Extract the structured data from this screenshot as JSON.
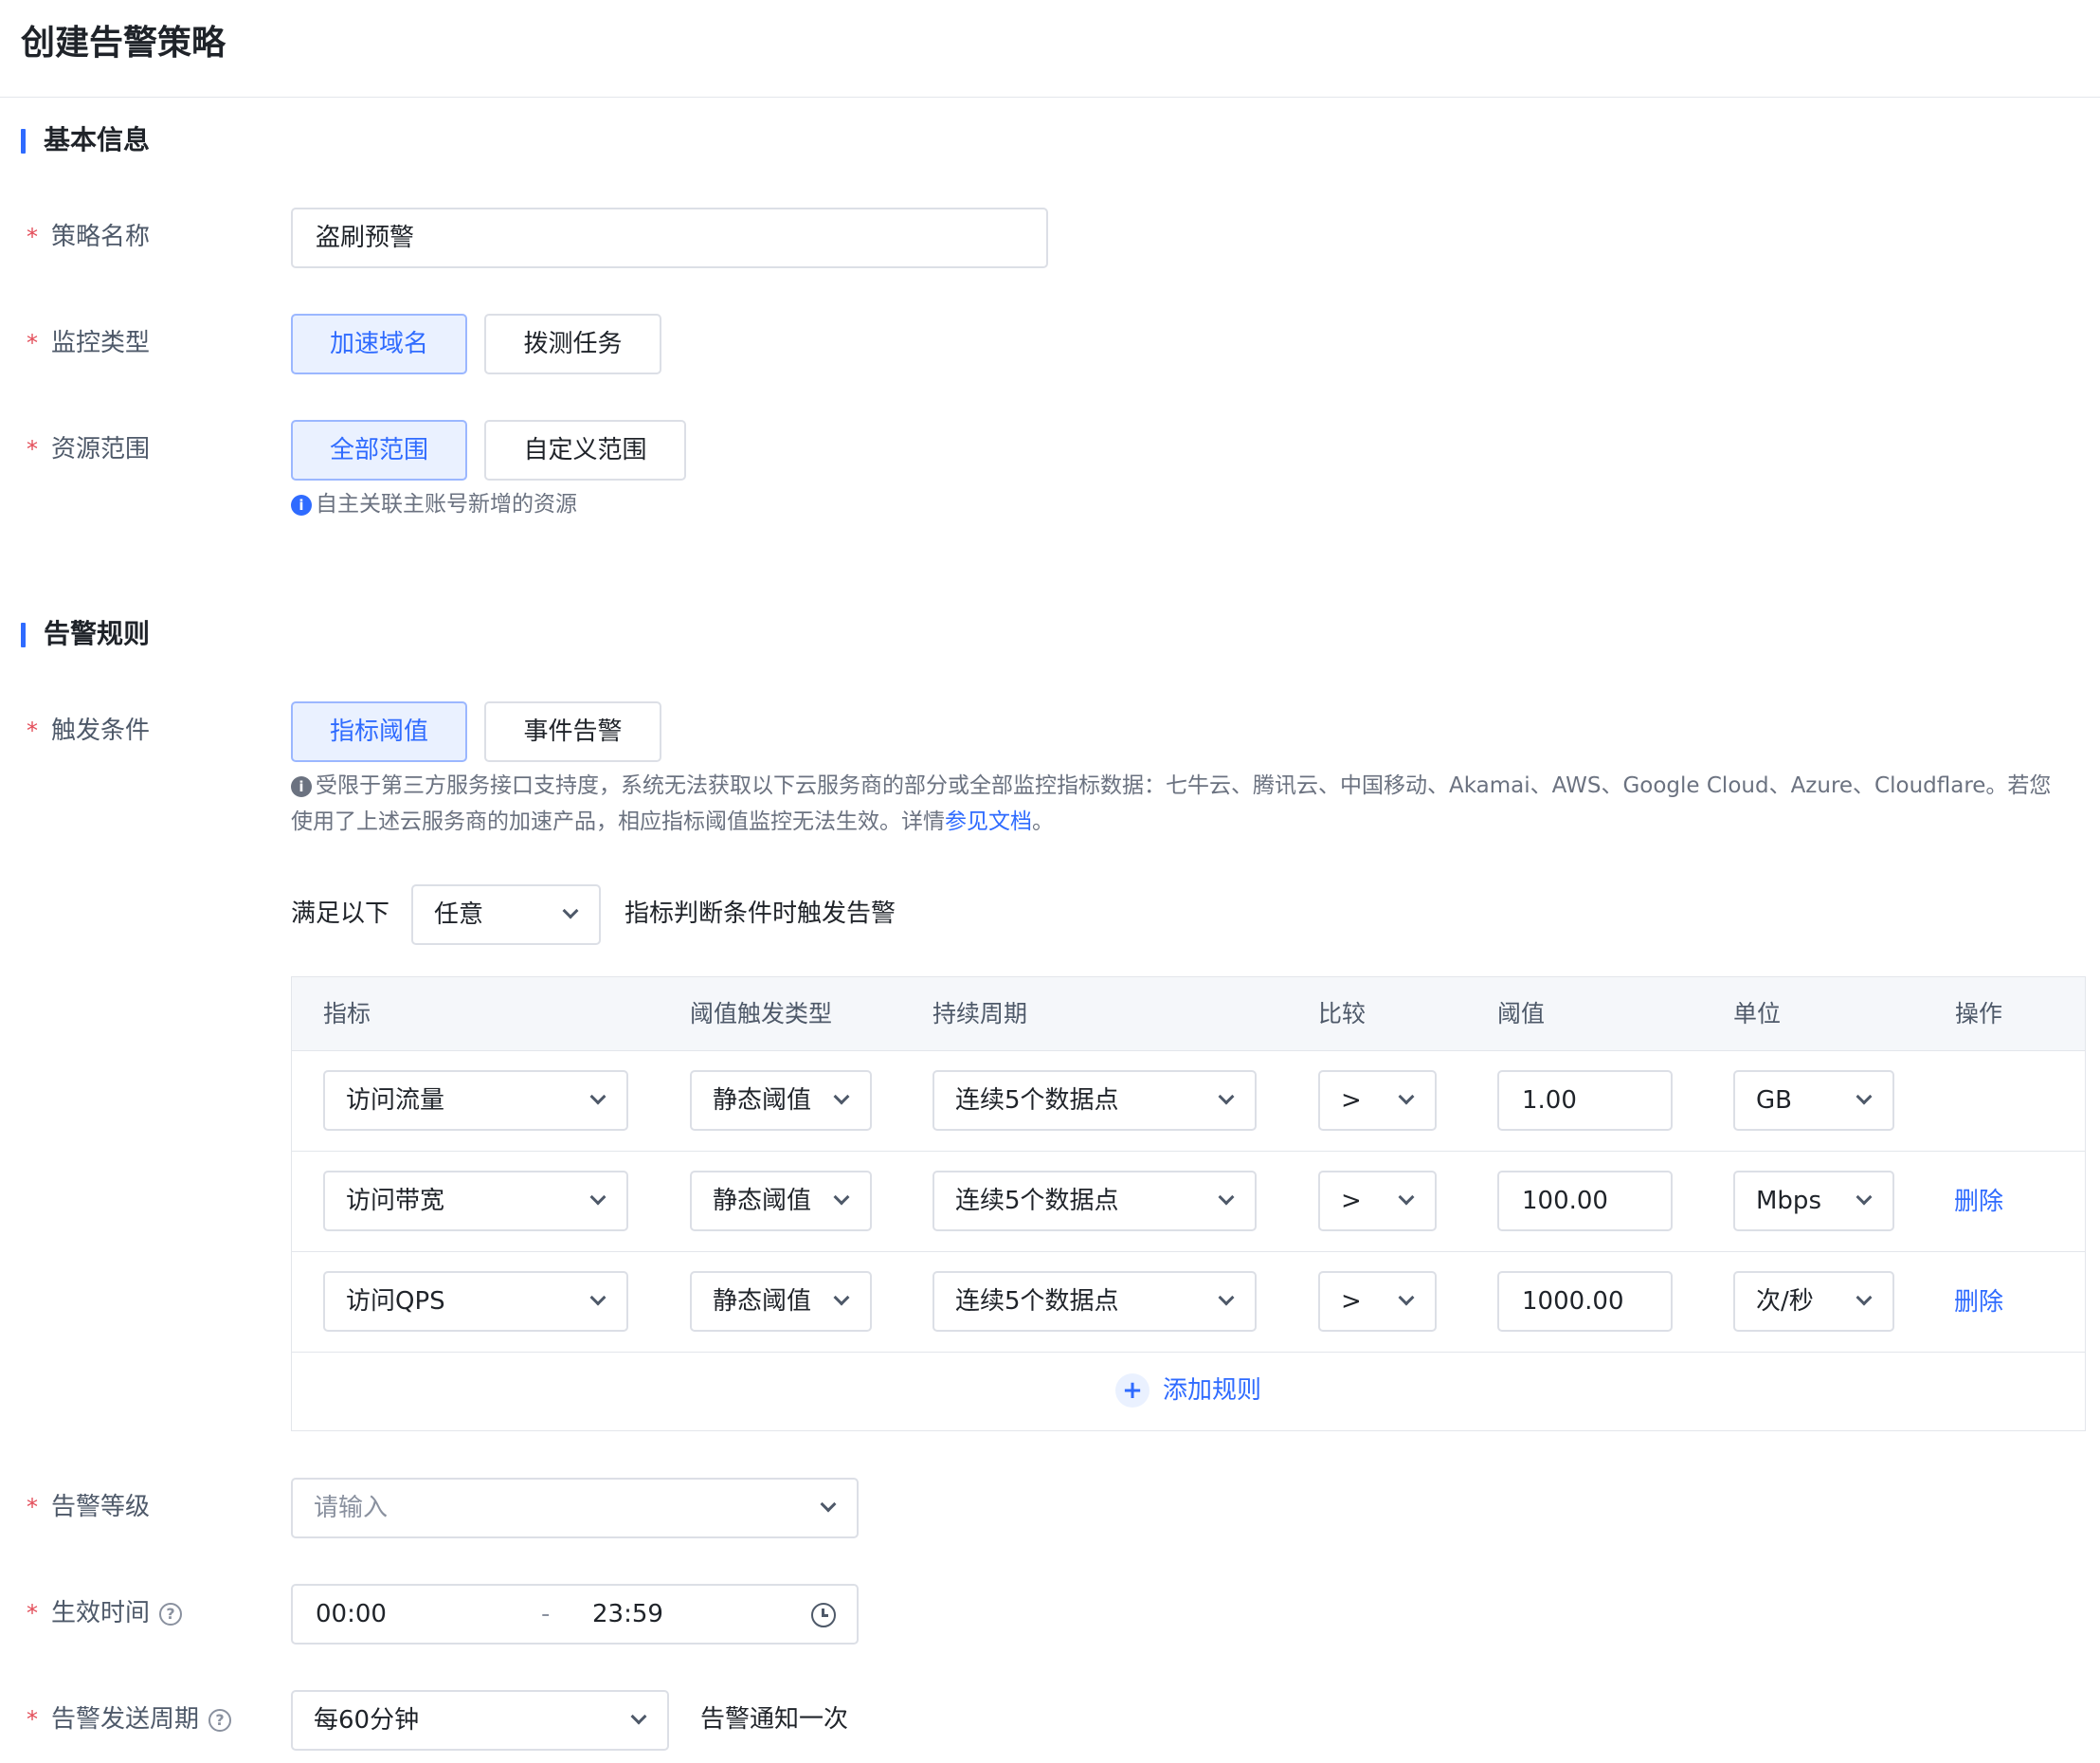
{
  "page": {
    "title": "创建告警策略"
  },
  "sections": {
    "basic": "基本信息",
    "rules": "告警规则"
  },
  "basic": {
    "name": {
      "label": "策略名称",
      "value": "盗刷预警"
    },
    "monitor_type": {
      "label": "监控类型",
      "options": [
        "加速域名",
        "拨测任务"
      ],
      "selected": "加速域名"
    },
    "scope": {
      "label": "资源范围",
      "options": [
        "全部范围",
        "自定义范围"
      ],
      "selected": "全部范围",
      "hint": "自主关联主账号新增的资源"
    }
  },
  "rules": {
    "trigger": {
      "label": "触发条件",
      "options": [
        "指标阈值",
        "事件告警"
      ],
      "selected": "指标阈值",
      "hint_line1": "受限于第三方服务接口支持度，系统无法获取以下云服务商的部分或全部监控指标数据：七牛云、腾讯云、中国移动、Akamai、AWS、Google Cloud、Azure、Cloudflare。若您",
      "hint_line2": "使用了上述云服务商的加速产品，相应指标阈值监控无法生效。详情",
      "hint_link": "参见文档",
      "hint_end": "。"
    },
    "condition": {
      "prefix": "满足以下",
      "mode": "任意",
      "suffix": "指标判断条件时触发告警"
    },
    "table": {
      "headers": [
        "指标",
        "阈值触发类型",
        "持续周期",
        "比较",
        "阈值",
        "单位",
        "操作"
      ],
      "rows": [
        {
          "metric": "访问流量",
          "type": "静态阈值",
          "period": "连续5个数据点",
          "compare": ">",
          "threshold": "1.00",
          "unit": "GB",
          "action": ""
        },
        {
          "metric": "访问带宽",
          "type": "静态阈值",
          "period": "连续5个数据点",
          "compare": ">",
          "threshold": "100.00",
          "unit": "Mbps",
          "action": "删除"
        },
        {
          "metric": "访问QPS",
          "type": "静态阈值",
          "period": "连续5个数据点",
          "compare": ">",
          "threshold": "1000.00",
          "unit": "次/秒",
          "action": "删除"
        }
      ],
      "add_label": "添加规则"
    },
    "level": {
      "label": "告警等级",
      "placeholder": "请输入"
    },
    "effective_time": {
      "label": "生效时间",
      "start": "00:00",
      "separator": "-",
      "end": "23:59"
    },
    "send_period": {
      "label": "告警发送周期",
      "value": "每60分钟",
      "suffix": "告警通知一次"
    }
  },
  "required_mark": "*",
  "help_glyph": "?",
  "info_glyph": "i",
  "plus_glyph": "+",
  "colors": {
    "accent": "#2f6bff",
    "required": "#e34d59",
    "active_bg": "#eaf1ff"
  }
}
